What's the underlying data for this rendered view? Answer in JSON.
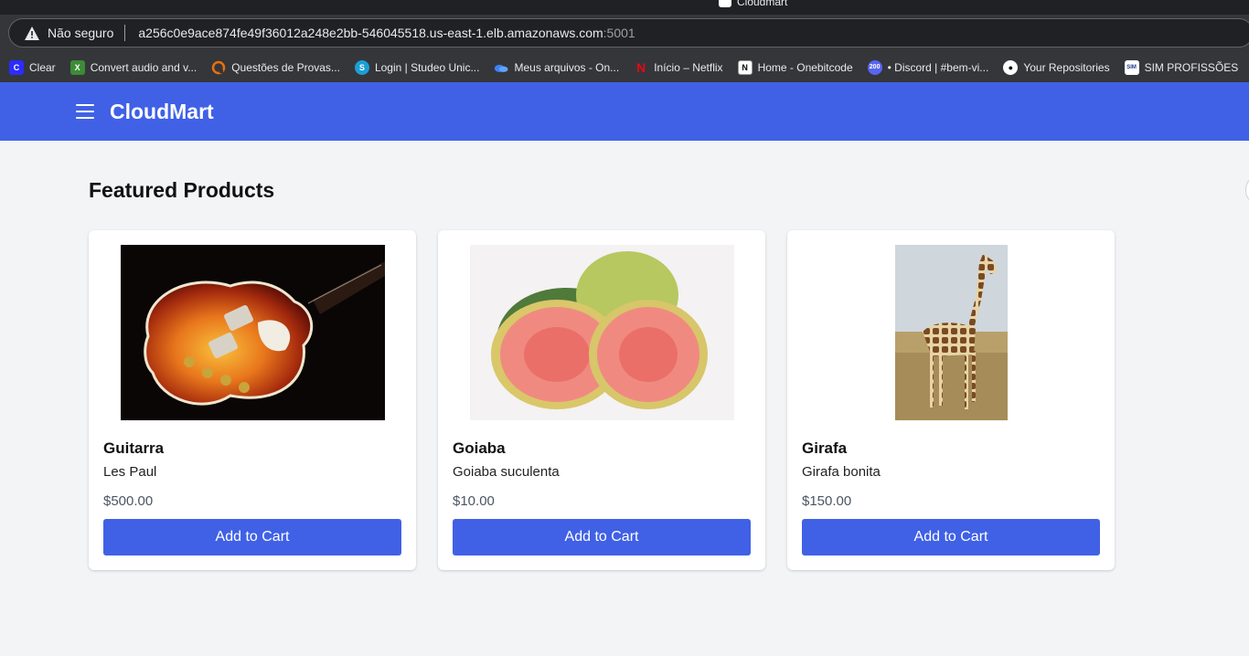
{
  "browser": {
    "tab_title": "Cloudmart",
    "security_label": "Não seguro",
    "url_host": "a256c0e9ace874fe49f36012a248e2bb-546045518.us-east-1.elb.amazonaws.com",
    "url_port": ":5001",
    "bookmarks": [
      {
        "label": "Clear",
        "icon": "clear-icon",
        "color": "#2c2cff"
      },
      {
        "label": "Convert audio and v...",
        "icon": "convert-icon",
        "color": "#3d8b37"
      },
      {
        "label": "Questões de Provas...",
        "icon": "questoes-icon",
        "color": "#e8710a"
      },
      {
        "label": "Login | Studeo Unic...",
        "icon": "studeo-icon",
        "color": "#1a9fd6"
      },
      {
        "label": "Meus arquivos - On...",
        "icon": "onedrive-icon",
        "color": "#3b82f6"
      },
      {
        "label": "Início – Netflix",
        "icon": "netflix-icon",
        "color": "#e50914"
      },
      {
        "label": "Home - Onebitcode",
        "icon": "notion-icon",
        "color": "#ffffff"
      },
      {
        "label": "• Discord | #bem-vi...",
        "icon": "discord-icon",
        "color": "#5865f2"
      },
      {
        "label": "Your Repositories",
        "icon": "github-icon",
        "color": "#ffffff"
      },
      {
        "label": "SIM PROFISSÕES",
        "icon": "sim-icon",
        "color": "#ffffff"
      }
    ]
  },
  "app": {
    "brand": "CloudMart",
    "section_title": "Featured Products",
    "accent_color": "#4061e6",
    "products": [
      {
        "name": "Guitarra",
        "description": "Les Paul",
        "price": "$500.00",
        "button": "Add to Cart",
        "image": "electric-guitar"
      },
      {
        "name": "Goiaba",
        "description": "Goiaba suculenta",
        "price": "$10.00",
        "button": "Add to Cart",
        "image": "guava-fruit"
      },
      {
        "name": "Girafa",
        "description": "Girafa bonita",
        "price": "$150.00",
        "button": "Add to Cart",
        "image": "giraffe"
      }
    ]
  }
}
